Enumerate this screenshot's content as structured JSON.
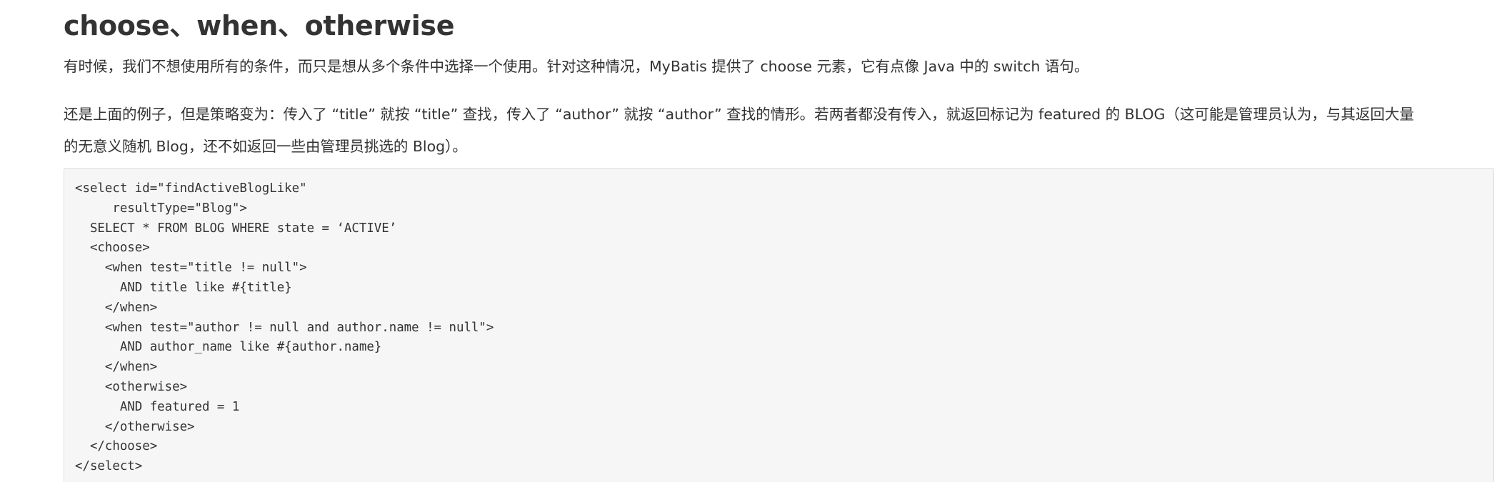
{
  "heading": "choose、when、otherwise",
  "paragraphs": [
    "有时候，我们不想使用所有的条件，而只是想从多个条件中选择一个使用。针对这种情况，MyBatis 提供了 choose 元素，它有点像 Java 中的 switch 语句。",
    "还是上面的例子，但是策略变为：传入了 “title” 就按 “title” 查找，传入了 “author” 就按 “author” 查找的情形。若两者都没有传入，就返回标记为 featured 的 BLOG（这可能是管理员认为，与其返回大量",
    "的无意义随机 Blog，还不如返回一些由管理员挑选的 Blog）。"
  ],
  "code": {
    "lines": [
      "<select id=\"findActiveBlogLike\"",
      "     resultType=\"Blog\">",
      "  SELECT * FROM BLOG WHERE state = ‘ACTIVE’",
      "  <choose>",
      "    <when test=\"title != null\">",
      "      AND title like #{title}",
      "    </when>",
      "    <when test=\"author != null and author.name != null\">",
      "      AND author_name like #{author.name}",
      "    </when>",
      "    <otherwise>",
      "      AND featured = 1",
      "    </otherwise>",
      "  </choose>",
      "</select>"
    ]
  },
  "colors": {
    "text": "#333333",
    "code_background": "#f6f6f6",
    "code_border": "#dddddd"
  }
}
